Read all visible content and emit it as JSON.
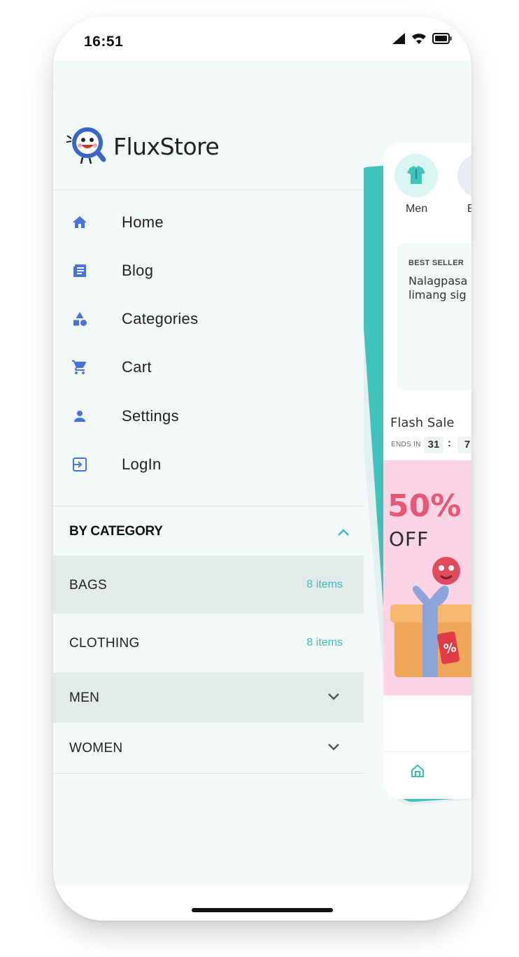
{
  "status_bar": {
    "time": "16:51"
  },
  "brand": {
    "name": "FluxStore"
  },
  "menu": {
    "items": [
      {
        "label": "Home",
        "icon": "home-icon"
      },
      {
        "label": "Blog",
        "icon": "blog-icon"
      },
      {
        "label": "Categories",
        "icon": "categories-icon"
      },
      {
        "label": "Cart",
        "icon": "cart-icon"
      },
      {
        "label": "Settings",
        "icon": "person-icon"
      },
      {
        "label": "LogIn",
        "icon": "login-icon"
      }
    ]
  },
  "by_category": {
    "title": "BY CATEGORY",
    "rows": [
      {
        "name": "BAGS",
        "count": "8 items"
      },
      {
        "name": "CLOTHING",
        "count": "8 items"
      },
      {
        "name": "MEN"
      },
      {
        "name": "WOMEN"
      }
    ]
  },
  "preview": {
    "categories": [
      "Men",
      "B"
    ],
    "best_seller_tag": "BEST SELLER",
    "best_seller_line1": "Nalagpasa",
    "best_seller_line2": "limang sig",
    "flash_title": "Flash Sale",
    "ends_in": "ENDS IN",
    "timer_1": "31",
    "timer_sep": ":",
    "timer_2": "7",
    "banner_percent": "50%",
    "banner_off": "OFF"
  },
  "colors": {
    "accent": "#3cbfb4",
    "icon_blue": "#4a72d8",
    "drawer_bg": "#f3f8f8",
    "row_highlight": "#e2eaea",
    "banner_pink": "#fbd5e5"
  }
}
